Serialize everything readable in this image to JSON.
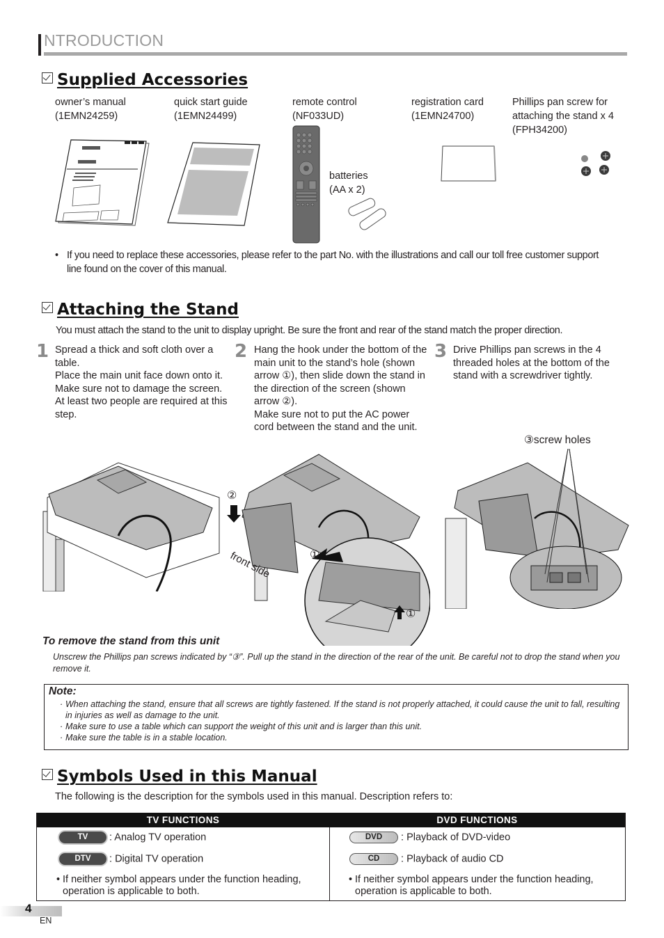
{
  "header": {
    "title": "NTRODUCTION"
  },
  "supplied_accessories": {
    "heading": "Supplied Accessories",
    "items": [
      {
        "name": "owner’s manual",
        "part": "(1EMN24259)",
        "icon": "manual-booklet-icon"
      },
      {
        "name": "quick start guide",
        "part": "(1EMN24499)",
        "icon": "quick-guide-icon"
      },
      {
        "name": "remote control",
        "part": "(NF033UD)",
        "icon": "remote-control-icon"
      },
      {
        "name": "registration card",
        "part": "(1EMN24700)",
        "icon": "registration-card-icon"
      },
      {
        "name": "Phillips pan screw for",
        "name2": "attaching the stand x 4",
        "part": "(FPH34200)",
        "icon": "screws-icon"
      }
    ],
    "batteries": {
      "line1": "batteries",
      "line2": "(AA x 2)",
      "battery_label": "AA"
    },
    "note": "If you need to replace these accessories, please refer to the part No. with the illustrations and call our toll free customer support line found on the cover of this manual."
  },
  "attaching_stand": {
    "heading": "Attaching the Stand",
    "intro": "You must attach the stand to the unit to display upright. Be sure the front and rear of the stand match the proper direction.",
    "steps": [
      {
        "num": "1",
        "text": "Spread a thick and soft cloth over a table.\nPlace the main unit face down onto it.\nMake sure not to damage the screen.\nAt least two people are required at this step."
      },
      {
        "num": "2",
        "text": "Hang the hook under the bottom of the main unit to the stand’s hole (shown arrow ①), then slide down the stand in the direction of the screen (shown arrow ②).\nMake sure not to put the AC power cord between the stand and the unit."
      },
      {
        "num": "3",
        "text": "Drive Phillips pan screws in the 4 threaded holes at the bottom of the stand with a screwdriver tightly."
      }
    ],
    "callouts": {
      "screw_holes": "③screw holes",
      "arrow1": "①",
      "arrow2": "②",
      "front_side": "front side"
    },
    "remove": {
      "title": "To remove the stand from this unit",
      "text": "Unscrew the Phillips pan screws indicated by “③”. Pull up the stand in the direction of the rear of the unit. Be careful not to drop the stand when you remove it."
    },
    "note": {
      "title": "Note:",
      "bullets": [
        "When attaching the stand, ensure that all screws are tightly fastened. If the stand is not properly attached, it could cause the unit to fall, resulting in injuries as well as damage to the unit.",
        "Make sure to use a table which can support the weight of this unit and is larger than this unit.",
        "Make sure the table is in a stable location."
      ]
    }
  },
  "symbols": {
    "heading": "Symbols Used in this Manual",
    "intro": "The following is the description for the symbols used in this manual. Description refers to:",
    "tv": {
      "header": "TV FUNCTIONS",
      "rows": [
        {
          "badge": "TV",
          "desc": ": Analog TV operation"
        },
        {
          "badge": "DTV",
          "desc": ": Digital TV operation"
        }
      ],
      "note": "If neither symbol appears under the function heading, operation is applicable to both."
    },
    "dvd": {
      "header": "DVD FUNCTIONS",
      "rows": [
        {
          "badge": "DVD",
          "desc": ": Playback of DVD-video"
        },
        {
          "badge": "CD",
          "desc": ": Playback of audio CD"
        }
      ],
      "note": "If neither symbol appears under the function heading, operation is applicable to both."
    }
  },
  "footer": {
    "page": "4",
    "lang": "EN"
  }
}
